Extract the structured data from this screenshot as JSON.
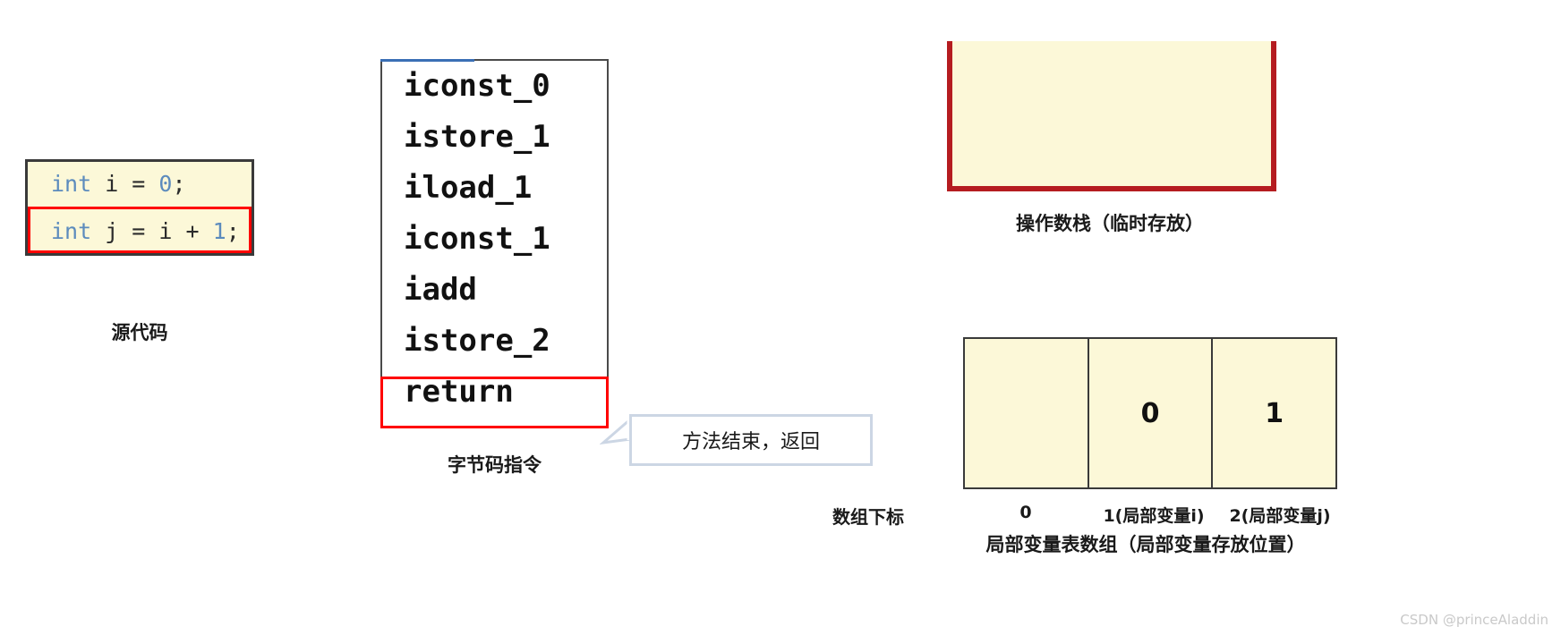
{
  "source_panel": {
    "caption": "源代码",
    "lines": [
      {
        "keyword": "int",
        "rest": " i = ",
        "value": "0",
        "end": ";",
        "highlighted": false
      },
      {
        "keyword": "int",
        "rest": " j = i + ",
        "value": "1",
        "end": ";",
        "highlighted": true
      }
    ]
  },
  "bytecode_panel": {
    "caption": "字节码指令",
    "instructions": [
      "iconst_0",
      "istore_1",
      "iload_1",
      "iconst_1",
      "iadd",
      "istore_2",
      "return"
    ],
    "highlighted_instruction": "return"
  },
  "callout": {
    "text": "方法结束，返回"
  },
  "operand_stack": {
    "caption": "操作数栈（临时存放）",
    "contents": []
  },
  "local_variable_table": {
    "caption": "局部变量表数组（局部变量存放位置）",
    "index_row_title": "数组下标",
    "cells": [
      {
        "value": "",
        "index_label": "0"
      },
      {
        "value": "0",
        "index_label": "1(局部变量i)"
      },
      {
        "value": "1",
        "index_label": "2(局部变量j)"
      }
    ]
  },
  "watermark": {
    "text": "CSDN @princeAladdin"
  },
  "colors": {
    "cream_fill": "#fcf8d8",
    "highlight_red": "#ff0000",
    "stack_border_red": "#b51c20",
    "code_keyword_blue": "#5c8bbd",
    "panel_border_dark": "#3a3a3a",
    "callout_border": "#ccd6e4",
    "bytecode_accent_blue": "#3a6fb5"
  }
}
